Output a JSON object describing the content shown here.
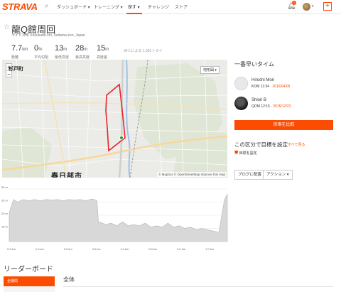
{
  "nav": {
    "logo": "STRAVA",
    "items": [
      {
        "label": "ダッシュボード ▾"
      },
      {
        "label": "トレーニング ▾"
      },
      {
        "label": "探す ▾"
      },
      {
        "label": "チャレンジ"
      },
      {
        "label": "ストア"
      }
    ],
    "notification_count": "1"
  },
  "segment": {
    "title": "龍Q館周回",
    "subtitle": "ライド日本 Kasukabe-shi, Saitama-ken, Japan",
    "stats": [
      {
        "value": "7.7",
        "unit": "km",
        "label": "距離"
      },
      {
        "value": "0",
        "unit": "%",
        "label": "平均勾配"
      },
      {
        "value": "13",
        "unit": "m",
        "label": "最低高度"
      },
      {
        "value": "28",
        "unit": "m",
        "label": "最高高度"
      },
      {
        "value": "15",
        "unit": "m",
        "label": "高度差"
      }
    ],
    "attempts": "34人による 1,301トライ"
  },
  "map": {
    "place_large": "春日部市",
    "place_small": "杉戸町",
    "zoom_in": "+",
    "zoom_out": "−",
    "map_type": "地形図 ▾",
    "attribution": "© Mapbox © OpenStreetMap Improve this map"
  },
  "sidebar": {
    "heading": "一番早いタイム",
    "leaders": [
      {
        "name": "Hiroshi Mori",
        "rank": "KOM",
        "time": "11:34",
        "date": "2016/04/09"
      },
      {
        "name": "Shiori B",
        "rank": "QOM",
        "time": "12:15",
        "date": "2015/12/23"
      }
    ],
    "compare_label": "良現を比較",
    "goal_heading": "この区分で目標を設定",
    "goal_link": "すべて見る",
    "goal_set": "目標を設定",
    "blog_button": "ブログに配置",
    "action_button": "アクション ▾"
  },
  "elevation": {
    "y_ticks": [
      "30 m",
      "25 m",
      "20 m",
      "15 m"
    ],
    "x_ticks": [
      "0.0 km",
      "1.0 km",
      "2.0 km",
      "3.0 km",
      "4.0 km",
      "5.0 km",
      "6.0 km",
      "7.0 km"
    ],
    "ylim": [
      10,
      30
    ],
    "xlim": [
      0,
      7.7
    ],
    "x": [
      0,
      0.15,
      0.3,
      0.5,
      0.7,
      0.9,
      1.1,
      1.3,
      1.5,
      1.7,
      1.9,
      2.1,
      2.3,
      2.5,
      2.7,
      2.9,
      3.0,
      3.1,
      3.15,
      3.2,
      3.4,
      3.6,
      3.8,
      4.0,
      4.2,
      4.4,
      4.6,
      4.8,
      5.0,
      5.2,
      5.4,
      5.6,
      5.8,
      6.0,
      6.2,
      6.4,
      6.6,
      6.8,
      7.0,
      7.2,
      7.4,
      7.6,
      7.7
    ],
    "y": [
      21,
      26,
      25,
      26,
      25.5,
      26,
      25.5,
      26,
      25.8,
      26,
      25.5,
      26,
      25.8,
      26,
      25.5,
      26.2,
      26,
      25.5,
      17,
      17.5,
      16.5,
      17,
      16,
      17.5,
      16,
      16.5,
      16,
      17,
      15.5,
      16,
      15.5,
      17,
      15.5,
      16,
      15,
      15.5,
      14.5,
      15,
      14.5,
      14,
      13.5,
      26,
      28
    ]
  },
  "leaderboard": {
    "title": "リーダーボード",
    "tab_label": "全期間",
    "section": "全体"
  },
  "colors": {
    "accent": "#fc4c02",
    "route": "#e8242b",
    "elevation_fill": "#d8d8d8"
  }
}
